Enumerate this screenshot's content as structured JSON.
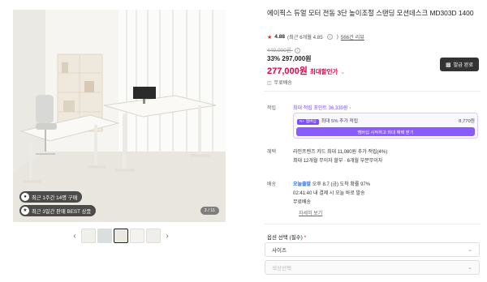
{
  "gallery": {
    "badges": [
      "최근 1주간 14명 구매",
      "최근 3일간 판매 BEST 상품"
    ],
    "counter": "3 / 11",
    "badge_icons": [
      "users-icon",
      "trophy-icon"
    ]
  },
  "product": {
    "title": "에이픽스 듀얼 모터 전동 3단 높이조절 스탠딩 모션데스크 MD303D 1400",
    "rating": "4.88",
    "rating_detail": "(최근 6개월 4.85",
    "review_link": "566건 리뷰",
    "list_price": "449,000원",
    "discount_rate": "33%",
    "sale_price": "297,000원",
    "max_price": "277,000원",
    "max_price_label": "최대할인가",
    "coupon_label": "발급 완료",
    "shipping_icon": "무료배송 icon",
    "shipping": "무료배송"
  },
  "points": {
    "label": "적립",
    "max_points": "최대 적립 포인트 36,330원",
    "membership_tag": "N+ 멤버십",
    "membership_text": "최대 5% 추가 적립",
    "membership_amount": "8,770원",
    "membership_button": "멤버십 시작하고 최대 혜택 받기"
  },
  "benefits": {
    "label": "혜택",
    "line1": "라인프렌즈 카드 최대 11,080원 추가 적립(4%)",
    "line2": "최대 12개월 무이자 할부 · 6개월 부분무이자"
  },
  "delivery": {
    "label": "배송",
    "tag": "오늘출발",
    "line1": "오후 8.7 (금) 도착 확률 97%",
    "line2": "02:41:40 내 결제 시 오늘 바로 발송",
    "line3": "무료배송",
    "detail_link": "자세히 보기"
  },
  "options": {
    "title": "옵션 선택 (필수)",
    "required_mark": "*",
    "size_label": "사이즈",
    "color_label": "색상선택"
  },
  "colors": {
    "accent": "#e0004d",
    "membership": "#8a5cff",
    "star": "#e2282e"
  }
}
